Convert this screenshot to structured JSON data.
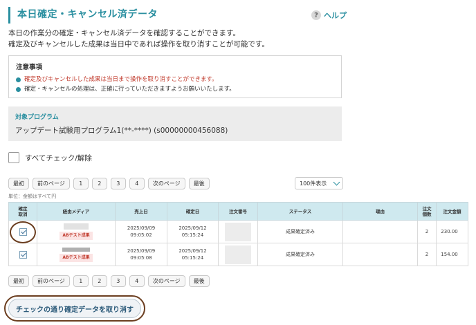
{
  "header": {
    "title": "本日確定・キャンセル済データ",
    "help_label": "ヘルプ",
    "help_icon": "question-icon"
  },
  "description": {
    "line1": "本日の作業分の確定・キャンセル済データを確認することができます。",
    "line2": "確定及びキャンセルした成果は当日中であれば操作を取り消すことが可能です。"
  },
  "notice": {
    "title": "注意事項",
    "items": [
      "確定及びキャンセルした成果は当日まで操作を取り消すことができます。",
      "確定・キャンセルの処理は、正確に行っていただきますようお願いいたします。"
    ]
  },
  "program": {
    "label": "対象プログラム",
    "name": "アップデート試験用プログラム1(**-****) (s00000000456088)"
  },
  "check_all": {
    "label": "すべてチェック/解除",
    "checked": false
  },
  "pager": {
    "first": "最初",
    "prev": "前のページ",
    "pages": [
      "1",
      "2",
      "3",
      "4"
    ],
    "next": "次のページ",
    "last": "最後"
  },
  "per_page": {
    "selected": "100件表示"
  },
  "unit_note": "単位：金額はすべて円",
  "table": {
    "headers": {
      "cancel": [
        "確定",
        "取消"
      ],
      "media": "経由メディア",
      "sale_date": "売上日",
      "confirm_date": "確定日",
      "order_no": "注文番号",
      "status": "ステータス",
      "reason": "理由",
      "count": [
        "注文",
        "個数"
      ],
      "amount": "注文金額"
    },
    "rows": [
      {
        "checked": true,
        "badge": "ABテスト成果",
        "sale_date": "2025/09/09",
        "sale_time": "09:05:02",
        "confirm_date": "2025/09/12",
        "confirm_time": "05:15:24",
        "status": "成果確定済み",
        "reason": "",
        "count": "2",
        "amount": "230.00"
      },
      {
        "checked": true,
        "badge": "ABテスト成果",
        "sale_date": "2025/09/09",
        "sale_time": "09:05:08",
        "confirm_date": "2025/09/12",
        "confirm_time": "05:15:24",
        "status": "成果確定済み",
        "reason": "",
        "count": "2",
        "amount": "154.00"
      }
    ]
  },
  "cancel_button": "チェックの通り確定データを取り消す"
}
